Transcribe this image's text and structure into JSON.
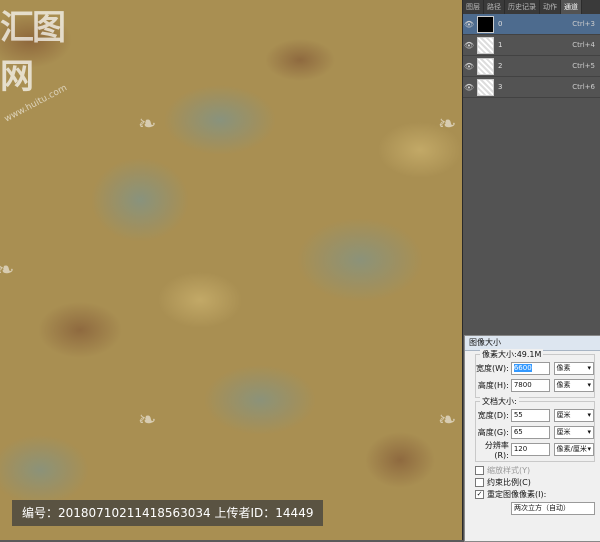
{
  "caption": {
    "text": "编号：20180710211418563034 上传者ID：14449"
  },
  "watermark": {
    "logo": "汇图网",
    "url": "www.huitu.com"
  },
  "layers_panel": {
    "tabs": [
      "图层",
      "路径",
      "历史记录",
      "动作",
      "通道"
    ],
    "active_tab": "通道",
    "channels": [
      {
        "name": "0",
        "shortcut": "Ctrl+3",
        "selected": true
      },
      {
        "name": "1",
        "shortcut": "Ctrl+4",
        "selected": false
      },
      {
        "name": "2",
        "shortcut": "Ctrl+5",
        "selected": false
      },
      {
        "name": "3",
        "shortcut": "Ctrl+6",
        "selected": false
      }
    ]
  },
  "image_size_dialog": {
    "title": "图像大小",
    "pixel_dims": {
      "legend": "像素大小:49.1M",
      "width_label": "宽度(W):",
      "width_value": "6600",
      "width_unit": "像素",
      "height_label": "高度(H):",
      "height_value": "7800",
      "height_unit": "像素"
    },
    "doc_size": {
      "legend": "文档大小:",
      "width_label": "宽度(D):",
      "width_value": "55",
      "width_unit": "厘米",
      "height_label": "高度(G):",
      "height_value": "65",
      "height_unit": "厘米",
      "res_label": "分辨率(R):",
      "res_value": "120",
      "res_unit": "像素/厘米"
    },
    "checks": {
      "scale_styles": "缩放样式(Y)",
      "constrain": "约束比例(C)",
      "resample": "重定图像像素(I):"
    },
    "method": "两次立方（自动）"
  }
}
